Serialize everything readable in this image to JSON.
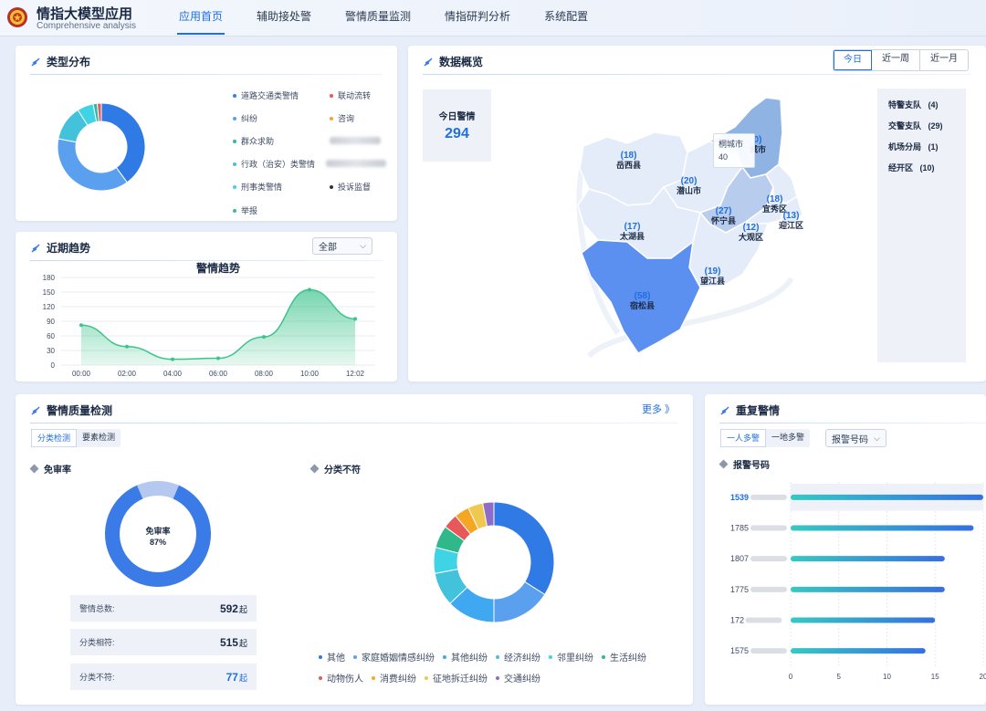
{
  "header": {
    "app_title": "情指大模型应用",
    "app_subtitle": "Comprehensive analysis",
    "nav": [
      "应用首页",
      "辅助接处警",
      "警情质量监测",
      "情指研判分析",
      "系统配置"
    ]
  },
  "type_panel": {
    "title": "类型分布",
    "legend": [
      {
        "label": "道路交通类警情",
        "color": "#3b7be8"
      },
      {
        "label": "联动流转",
        "color": "#e8585a"
      },
      {
        "label": "纠纷",
        "color": "#5aa0ee"
      },
      {
        "label": "咨询",
        "color": "#f5a623"
      },
      {
        "label": "群众求助",
        "color": "#2fb8a6"
      },
      {
        "label": "",
        "color": "#9aa5b4"
      },
      {
        "label": "行政（治安）类警情",
        "color": "#43c2dc"
      },
      {
        "label": "",
        "color": "#9aa5b4"
      },
      {
        "label": "刑事类警情",
        "color": "#3fd3e6"
      },
      {
        "label": "投诉监督",
        "color": "#333333"
      },
      {
        "label": "举报",
        "color": "#3fb89a"
      }
    ],
    "donut": [
      {
        "label": "道路交通类警情",
        "value": 40,
        "color": "#2f7ae5"
      },
      {
        "label": "纠纷",
        "value": 38,
        "color": "#5aa0ee"
      },
      {
        "label": "行政（治安）类警情",
        "value": 13,
        "color": "#43c2dc"
      },
      {
        "label": "刑事类警情",
        "value": 6,
        "color": "#3fd3e6"
      },
      {
        "label": "群众求助",
        "value": 1.5,
        "color": "#2fb8a6"
      },
      {
        "label": "联动流转",
        "value": 1.5,
        "color": "#e8585a"
      }
    ]
  },
  "trend_panel": {
    "title": "近期趋势",
    "select_value": "全部",
    "chart_data": {
      "type": "area",
      "title": "警情趋势",
      "x": [
        "00:00",
        "02:00",
        "04:00",
        "06:00",
        "08:00",
        "10:00",
        "12:02"
      ],
      "values": [
        82,
        38,
        12,
        14,
        58,
        155,
        95
      ],
      "ylim": [
        0,
        180
      ],
      "yticks": [
        0,
        30,
        60,
        90,
        120,
        150,
        180
      ],
      "color": "#3cc48c"
    }
  },
  "overview_panel": {
    "title": "数据概览",
    "ranges": [
      "今日",
      "近一周",
      "近一月"
    ],
    "today_label": "今日警情",
    "today_value": "294",
    "tooltip": {
      "name": "桐城市",
      "value": "40"
    },
    "regions": [
      {
        "name": "岳西县",
        "value": "(18)"
      },
      {
        "name": "潜山市",
        "value": "(20)"
      },
      {
        "name": "怀宁县",
        "value": "(27)"
      },
      {
        "name": "宜秀区",
        "value": "(18)"
      },
      {
        "name": "迎江区",
        "value": "(13)"
      },
      {
        "name": "大观区",
        "value": "(12)"
      },
      {
        "name": "太湖县",
        "value": "(17)"
      },
      {
        "name": "望江县",
        "value": "(19)"
      },
      {
        "name": "宿松县",
        "value": "(58)"
      },
      {
        "name": "城市",
        "value": "0)"
      }
    ],
    "units": [
      {
        "name": "特警支队",
        "value": "(4)"
      },
      {
        "name": "交警支队",
        "value": "(29)"
      },
      {
        "name": "机场分局",
        "value": "(1)"
      },
      {
        "name": "经开区",
        "value": "(10)"
      }
    ]
  },
  "quality_panel": {
    "title": "警情质量检测",
    "more": "更多 》",
    "tabs": [
      "分类检测",
      "要素检测"
    ],
    "left_title": "免审率",
    "gauge_label": "免审率",
    "gauge_value": "87%",
    "gauge_fraction": 0.87,
    "stats": [
      {
        "label": "警情总数:",
        "value": "592",
        "unit": "起"
      },
      {
        "label": "分类相符:",
        "value": "515",
        "unit": "起"
      },
      {
        "label": "分类不符:",
        "value": "77",
        "unit": "起"
      }
    ],
    "right_title": "分类不符",
    "donut": [
      {
        "label": "其他",
        "value": 34,
        "color": "#2f7ae5"
      },
      {
        "label": "家庭婚姻情感纠纷",
        "value": 16,
        "color": "#5aa0ee"
      },
      {
        "label": "其他纠纷",
        "value": 13,
        "color": "#3fa8f0"
      },
      {
        "label": "经济纠纷",
        "value": 9,
        "color": "#43c2dc"
      },
      {
        "label": "邻里纠纷",
        "value": 7,
        "color": "#3fd3e6"
      },
      {
        "label": "生活纠纷",
        "value": 6,
        "color": "#2fb88a"
      },
      {
        "label": "动物伤人",
        "value": 4,
        "color": "#e8585a"
      },
      {
        "label": "消费纠纷",
        "value": 4,
        "color": "#f5a623"
      },
      {
        "label": "征地拆迁纠纷",
        "value": 4,
        "color": "#f0c850"
      },
      {
        "label": "交通纠纷",
        "value": 3,
        "color": "#8e6cc8"
      }
    ]
  },
  "repeat_panel": {
    "title": "重复警情",
    "tabs": [
      "一人多警",
      "一地多警"
    ],
    "select_value": "报警号码",
    "sub_title": "报警号码",
    "chart_data": {
      "type": "bar",
      "categories": [
        "1539",
        "1785",
        "1807",
        "1775",
        "172",
        "1575"
      ],
      "values": [
        20,
        19,
        16,
        16,
        15,
        14
      ],
      "xlim": [
        0,
        20
      ],
      "xticks": [
        0,
        5,
        10,
        15,
        20
      ]
    }
  }
}
